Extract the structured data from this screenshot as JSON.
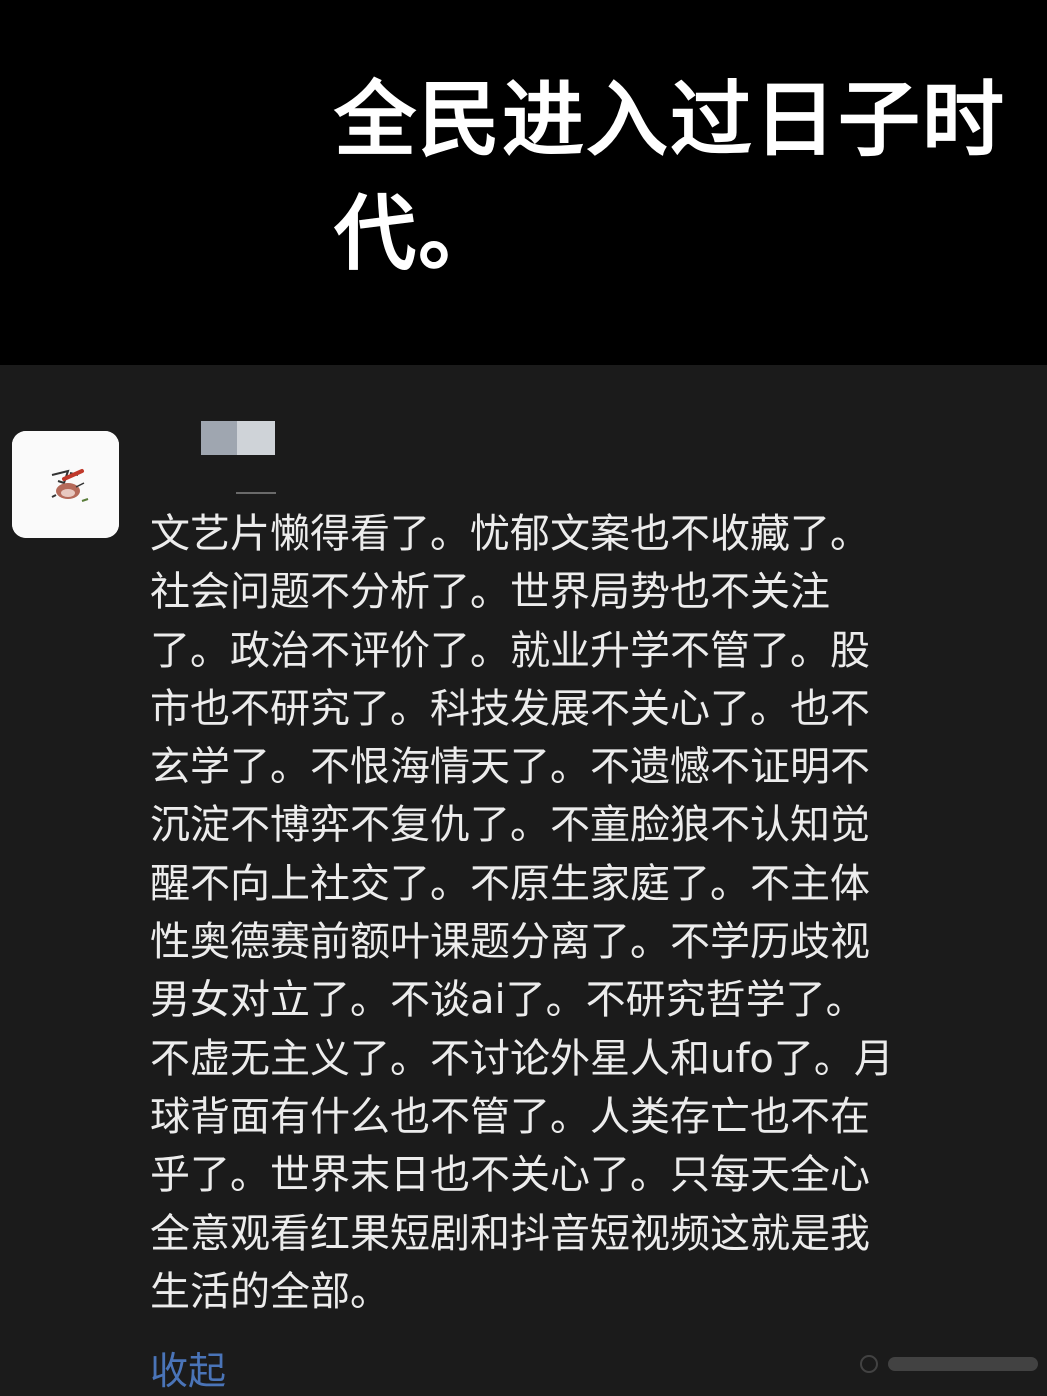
{
  "header": {
    "title_lines": [
      "全民进入过日子时",
      "代。"
    ]
  },
  "comment": {
    "lines": [
      "文艺片懒得看了。忧郁文案也不收藏了。",
      "社会问题不分析了。世界局势也不关注",
      "了。政治不评价了。就业升学不管了。股",
      "市也不研究了。科技发展不关心了。也不",
      "玄学了。不恨海情天了。不遗憾不证明不",
      "沉淀不博弈不复仇了。不童脸狼不认知觉",
      "醒不向上社交了。不原生家庭了。不主体",
      "性奥德赛前额叶课题分离了。不学历歧视",
      "男女对立了。不谈ai了。不研究哲学了。",
      "不虚无主义了。不讨论外星人和ufo了。月",
      "球背面有什么也不管了。人类存亡也不在",
      "乎了。世界末日也不关心了。只每天全心",
      "全意观看红果短剧和抖音短视频这就是我",
      "生活的全部。"
    ],
    "collapse_label": "收起"
  },
  "colors": {
    "header_bg": "#000000",
    "comment_bg": "#1b1b1b",
    "text": "#ececec",
    "link": "#4a74b8"
  }
}
